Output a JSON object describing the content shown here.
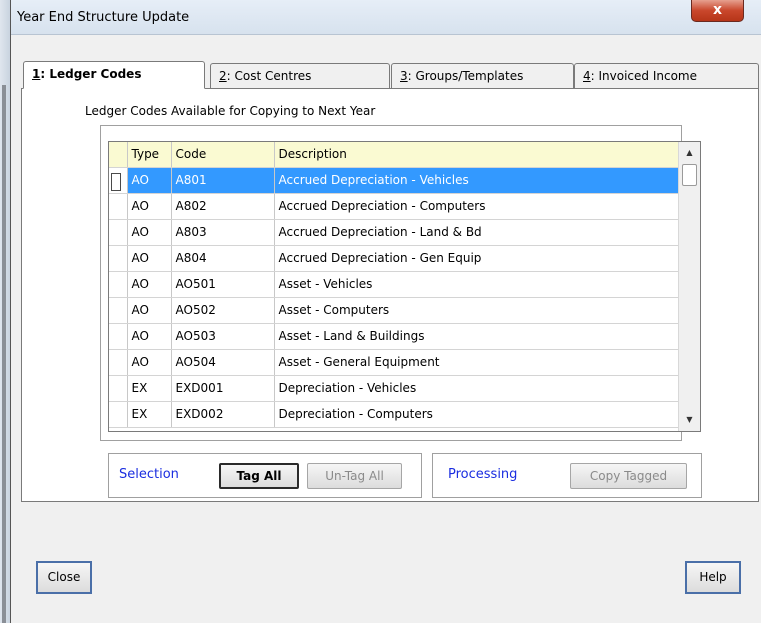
{
  "window": {
    "title": "Year End Structure Update",
    "close_glyph": "x"
  },
  "tabs": [
    {
      "key": "1",
      "label": ": Ledger Codes"
    },
    {
      "key": "2",
      "label": ": Cost Centres"
    },
    {
      "key": "3",
      "label": ": Groups/Templates"
    },
    {
      "key": "4",
      "label": ": Invoiced Income"
    }
  ],
  "panel": {
    "heading": "Ledger Codes Available for Copying to Next Year",
    "columns": [
      "Type",
      "Code",
      "Description"
    ],
    "rows": [
      {
        "type": "AO",
        "code": "A801",
        "description": "Accrued Depreciation - Vehicles",
        "selected": true
      },
      {
        "type": "AO",
        "code": "A802",
        "description": "Accrued Depreciation - Computers"
      },
      {
        "type": "AO",
        "code": "A803",
        "description": "Accrued Depreciation - Land & Bd"
      },
      {
        "type": "AO",
        "code": "A804",
        "description": "Accrued Depreciation - Gen Equip"
      },
      {
        "type": "AO",
        "code": "AO501",
        "description": "Asset - Vehicles"
      },
      {
        "type": "AO",
        "code": "AO502",
        "description": "Asset - Computers"
      },
      {
        "type": "AO",
        "code": "AO503",
        "description": "Asset - Land & Buildings"
      },
      {
        "type": "AO",
        "code": "AO504",
        "description": "Asset - General Equipment"
      },
      {
        "type": "EX",
        "code": "EXD001",
        "description": "Depreciation - Vehicles"
      },
      {
        "type": "EX",
        "code": "EXD002",
        "description": "Depreciation - Computers"
      }
    ]
  },
  "selection": {
    "label": "Selection",
    "tag_all": "Tag All",
    "untag_all": "Un-Tag All"
  },
  "processing": {
    "label": "Processing",
    "copy_tagged": "Copy Tagged"
  },
  "footer": {
    "close": "Close",
    "help": "Help"
  },
  "colors": {
    "selection": "#3399ff",
    "group_label": "#1a2de0",
    "header_bg": "#fafad2"
  }
}
